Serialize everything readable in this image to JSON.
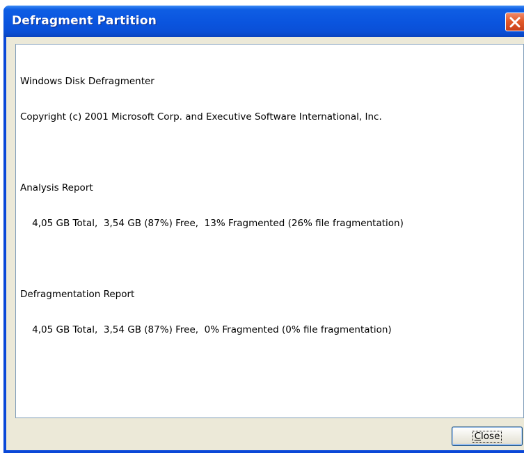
{
  "window": {
    "title": "Defragment Partition"
  },
  "report": {
    "lines": [
      "Windows Disk Defragmenter",
      "Copyright (c) 2001 Microsoft Corp. and Executive Software International, Inc.",
      "",
      "Analysis Report",
      "    4,05 GB Total,  3,54 GB (87%) Free,  13% Fragmented (26% file fragmentation)",
      "",
      "Defragmentation Report",
      "    4,05 GB Total,  3,54 GB (87%) Free,  0% Fragmented (0% file fragmentation)"
    ]
  },
  "buttons": {
    "close_mnemonic": "C",
    "close_rest": "lose"
  },
  "icons": {
    "title_close": "close-icon"
  },
  "colors": {
    "titlebar": "#0a54de",
    "title_close": "#e35a2a",
    "dialog_bg": "#ece9d8",
    "report_border": "#7f9db9"
  }
}
